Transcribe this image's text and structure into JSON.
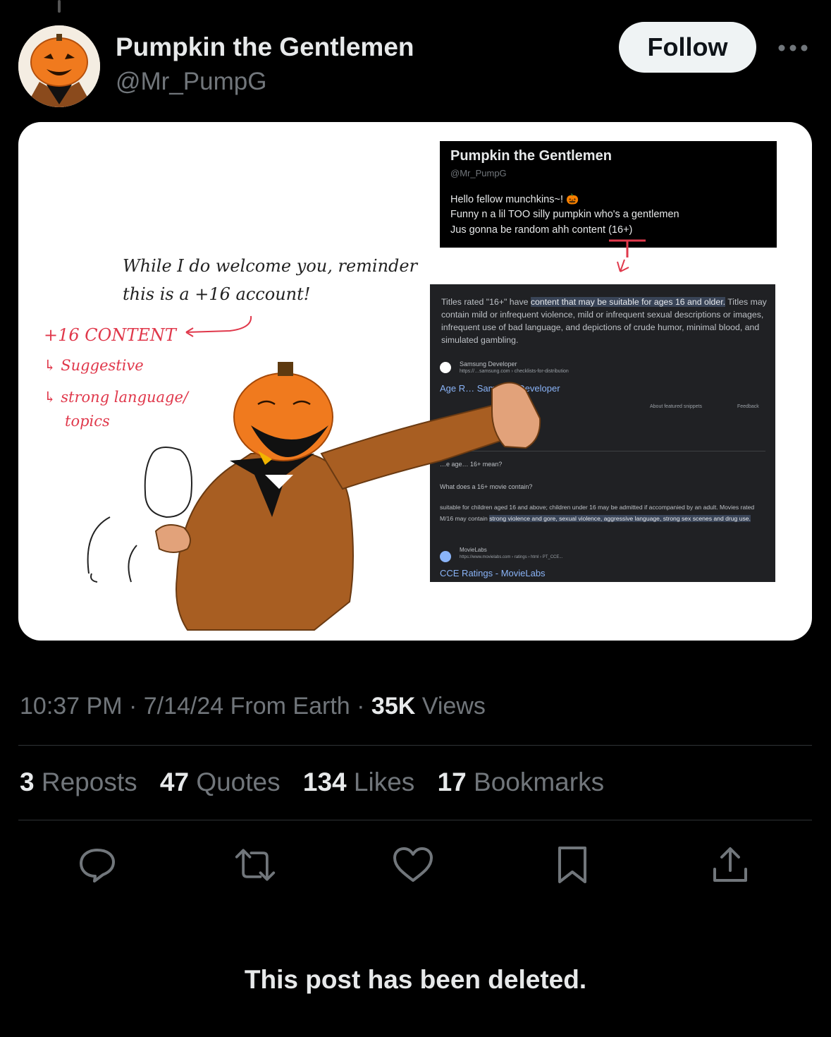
{
  "author": {
    "display_name": "Pumpkin the Gentlemen",
    "handle": "@Mr_PumpG",
    "avatar_icon": "pumpkin-avatar-icon"
  },
  "follow_button": {
    "label": "Follow"
  },
  "more_button": {
    "icon": "more-dots-icon"
  },
  "media": {
    "bio_card": {
      "name": "Pumpkin the Gentlemen",
      "handle": "@Mr_PumpG",
      "line1": "Hello fellow munchkins~! 🎃",
      "line2": "Funny n a lil TOO silly pumpkin who's a gentlemen",
      "line3": "Jus gonna be random ahh content (16+)"
    },
    "handwriting": {
      "line1": "While I do welcome you, reminder",
      "line2": "this is a +16 account!",
      "content_title": "+16 CONTENT",
      "item1": "↳ Suggestive",
      "item2": "↳ strong language/",
      "item3": "topics"
    },
    "search_card": {
      "intro": "Titles rated \"16+\" have ",
      "highlight": "content that may be suitable for ages 16 and older.",
      "rest": " Titles may contain mild or infrequent violence, mild or infrequent sexual descriptions or images, infrequent use of bad language, and depictions of crude humor, minimal blood, and simulated gambling.",
      "source1_name": "Samsung Developer",
      "source1_url": "https://…samsung.com › checklists-for-distribution",
      "source1_link": "Age R… Samsung Developer",
      "about_snippets": "About featured snippets",
      "feedback": "Feedback",
      "q1": "…e age… 16+ mean?",
      "q2": "What does a 16+ movie contain?",
      "answer_plain": "suitable for children aged 16 and above; children under 16 may be admitted if accompanied by an adult. Movies rated M/16 may contain ",
      "answer_highlight": "strong violence and gore, sexual violence, aggressive language, strong sex scenes and drug use.",
      "source2_name": "MovieLabs",
      "source2_url": "https://www.movielabs.com › ratings › html › PT_CCE...",
      "source2_link": "CCE Ratings - MovieLabs"
    }
  },
  "meta": {
    "time": "10:37 PM",
    "date": "7/14/24",
    "location": "From Earth",
    "views_count": "35K",
    "views_label": "Views"
  },
  "stats": {
    "reposts_count": "3",
    "reposts_label": "Reposts",
    "quotes_count": "47",
    "quotes_label": "Quotes",
    "likes_count": "134",
    "likes_label": "Likes",
    "bookmarks_count": "17",
    "bookmarks_label": "Bookmarks"
  },
  "actions": [
    "reply-icon",
    "repost-icon",
    "like-icon",
    "bookmark-icon",
    "share-icon"
  ],
  "deleted_notice": "This post has been deleted.",
  "colors": {
    "background": "#000000",
    "text": "#e7e9ea",
    "muted": "#71767b",
    "divider": "#2f3336",
    "annotation_red": "#e0384b"
  }
}
